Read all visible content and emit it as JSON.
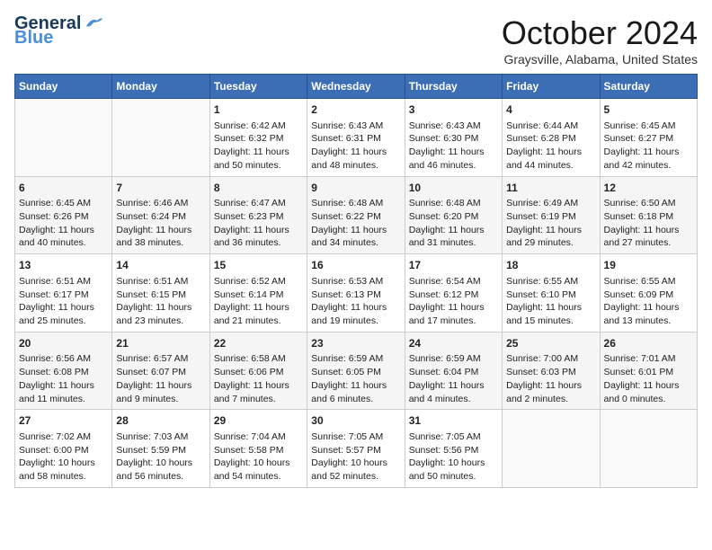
{
  "header": {
    "logo_general": "General",
    "logo_blue": "Blue",
    "title": "October 2024",
    "location": "Graysville, Alabama, United States"
  },
  "days_of_week": [
    "Sunday",
    "Monday",
    "Tuesday",
    "Wednesday",
    "Thursday",
    "Friday",
    "Saturday"
  ],
  "weeks": [
    [
      {
        "day": "",
        "empty": true
      },
      {
        "day": "",
        "empty": true
      },
      {
        "day": "1",
        "sunrise": "Sunrise: 6:42 AM",
        "sunset": "Sunset: 6:32 PM",
        "daylight": "Daylight: 11 hours and 50 minutes."
      },
      {
        "day": "2",
        "sunrise": "Sunrise: 6:43 AM",
        "sunset": "Sunset: 6:31 PM",
        "daylight": "Daylight: 11 hours and 48 minutes."
      },
      {
        "day": "3",
        "sunrise": "Sunrise: 6:43 AM",
        "sunset": "Sunset: 6:30 PM",
        "daylight": "Daylight: 11 hours and 46 minutes."
      },
      {
        "day": "4",
        "sunrise": "Sunrise: 6:44 AM",
        "sunset": "Sunset: 6:28 PM",
        "daylight": "Daylight: 11 hours and 44 minutes."
      },
      {
        "day": "5",
        "sunrise": "Sunrise: 6:45 AM",
        "sunset": "Sunset: 6:27 PM",
        "daylight": "Daylight: 11 hours and 42 minutes."
      }
    ],
    [
      {
        "day": "6",
        "sunrise": "Sunrise: 6:45 AM",
        "sunset": "Sunset: 6:26 PM",
        "daylight": "Daylight: 11 hours and 40 minutes."
      },
      {
        "day": "7",
        "sunrise": "Sunrise: 6:46 AM",
        "sunset": "Sunset: 6:24 PM",
        "daylight": "Daylight: 11 hours and 38 minutes."
      },
      {
        "day": "8",
        "sunrise": "Sunrise: 6:47 AM",
        "sunset": "Sunset: 6:23 PM",
        "daylight": "Daylight: 11 hours and 36 minutes."
      },
      {
        "day": "9",
        "sunrise": "Sunrise: 6:48 AM",
        "sunset": "Sunset: 6:22 PM",
        "daylight": "Daylight: 11 hours and 34 minutes."
      },
      {
        "day": "10",
        "sunrise": "Sunrise: 6:48 AM",
        "sunset": "Sunset: 6:20 PM",
        "daylight": "Daylight: 11 hours and 31 minutes."
      },
      {
        "day": "11",
        "sunrise": "Sunrise: 6:49 AM",
        "sunset": "Sunset: 6:19 PM",
        "daylight": "Daylight: 11 hours and 29 minutes."
      },
      {
        "day": "12",
        "sunrise": "Sunrise: 6:50 AM",
        "sunset": "Sunset: 6:18 PM",
        "daylight": "Daylight: 11 hours and 27 minutes."
      }
    ],
    [
      {
        "day": "13",
        "sunrise": "Sunrise: 6:51 AM",
        "sunset": "Sunset: 6:17 PM",
        "daylight": "Daylight: 11 hours and 25 minutes."
      },
      {
        "day": "14",
        "sunrise": "Sunrise: 6:51 AM",
        "sunset": "Sunset: 6:15 PM",
        "daylight": "Daylight: 11 hours and 23 minutes."
      },
      {
        "day": "15",
        "sunrise": "Sunrise: 6:52 AM",
        "sunset": "Sunset: 6:14 PM",
        "daylight": "Daylight: 11 hours and 21 minutes."
      },
      {
        "day": "16",
        "sunrise": "Sunrise: 6:53 AM",
        "sunset": "Sunset: 6:13 PM",
        "daylight": "Daylight: 11 hours and 19 minutes."
      },
      {
        "day": "17",
        "sunrise": "Sunrise: 6:54 AM",
        "sunset": "Sunset: 6:12 PM",
        "daylight": "Daylight: 11 hours and 17 minutes."
      },
      {
        "day": "18",
        "sunrise": "Sunrise: 6:55 AM",
        "sunset": "Sunset: 6:10 PM",
        "daylight": "Daylight: 11 hours and 15 minutes."
      },
      {
        "day": "19",
        "sunrise": "Sunrise: 6:55 AM",
        "sunset": "Sunset: 6:09 PM",
        "daylight": "Daylight: 11 hours and 13 minutes."
      }
    ],
    [
      {
        "day": "20",
        "sunrise": "Sunrise: 6:56 AM",
        "sunset": "Sunset: 6:08 PM",
        "daylight": "Daylight: 11 hours and 11 minutes."
      },
      {
        "day": "21",
        "sunrise": "Sunrise: 6:57 AM",
        "sunset": "Sunset: 6:07 PM",
        "daylight": "Daylight: 11 hours and 9 minutes."
      },
      {
        "day": "22",
        "sunrise": "Sunrise: 6:58 AM",
        "sunset": "Sunset: 6:06 PM",
        "daylight": "Daylight: 11 hours and 7 minutes."
      },
      {
        "day": "23",
        "sunrise": "Sunrise: 6:59 AM",
        "sunset": "Sunset: 6:05 PM",
        "daylight": "Daylight: 11 hours and 6 minutes."
      },
      {
        "day": "24",
        "sunrise": "Sunrise: 6:59 AM",
        "sunset": "Sunset: 6:04 PM",
        "daylight": "Daylight: 11 hours and 4 minutes."
      },
      {
        "day": "25",
        "sunrise": "Sunrise: 7:00 AM",
        "sunset": "Sunset: 6:03 PM",
        "daylight": "Daylight: 11 hours and 2 minutes."
      },
      {
        "day": "26",
        "sunrise": "Sunrise: 7:01 AM",
        "sunset": "Sunset: 6:01 PM",
        "daylight": "Daylight: 11 hours and 0 minutes."
      }
    ],
    [
      {
        "day": "27",
        "sunrise": "Sunrise: 7:02 AM",
        "sunset": "Sunset: 6:00 PM",
        "daylight": "Daylight: 10 hours and 58 minutes."
      },
      {
        "day": "28",
        "sunrise": "Sunrise: 7:03 AM",
        "sunset": "Sunset: 5:59 PM",
        "daylight": "Daylight: 10 hours and 56 minutes."
      },
      {
        "day": "29",
        "sunrise": "Sunrise: 7:04 AM",
        "sunset": "Sunset: 5:58 PM",
        "daylight": "Daylight: 10 hours and 54 minutes."
      },
      {
        "day": "30",
        "sunrise": "Sunrise: 7:05 AM",
        "sunset": "Sunset: 5:57 PM",
        "daylight": "Daylight: 10 hours and 52 minutes."
      },
      {
        "day": "31",
        "sunrise": "Sunrise: 7:05 AM",
        "sunset": "Sunset: 5:56 PM",
        "daylight": "Daylight: 10 hours and 50 minutes."
      },
      {
        "day": "",
        "empty": true
      },
      {
        "day": "",
        "empty": true
      }
    ]
  ]
}
